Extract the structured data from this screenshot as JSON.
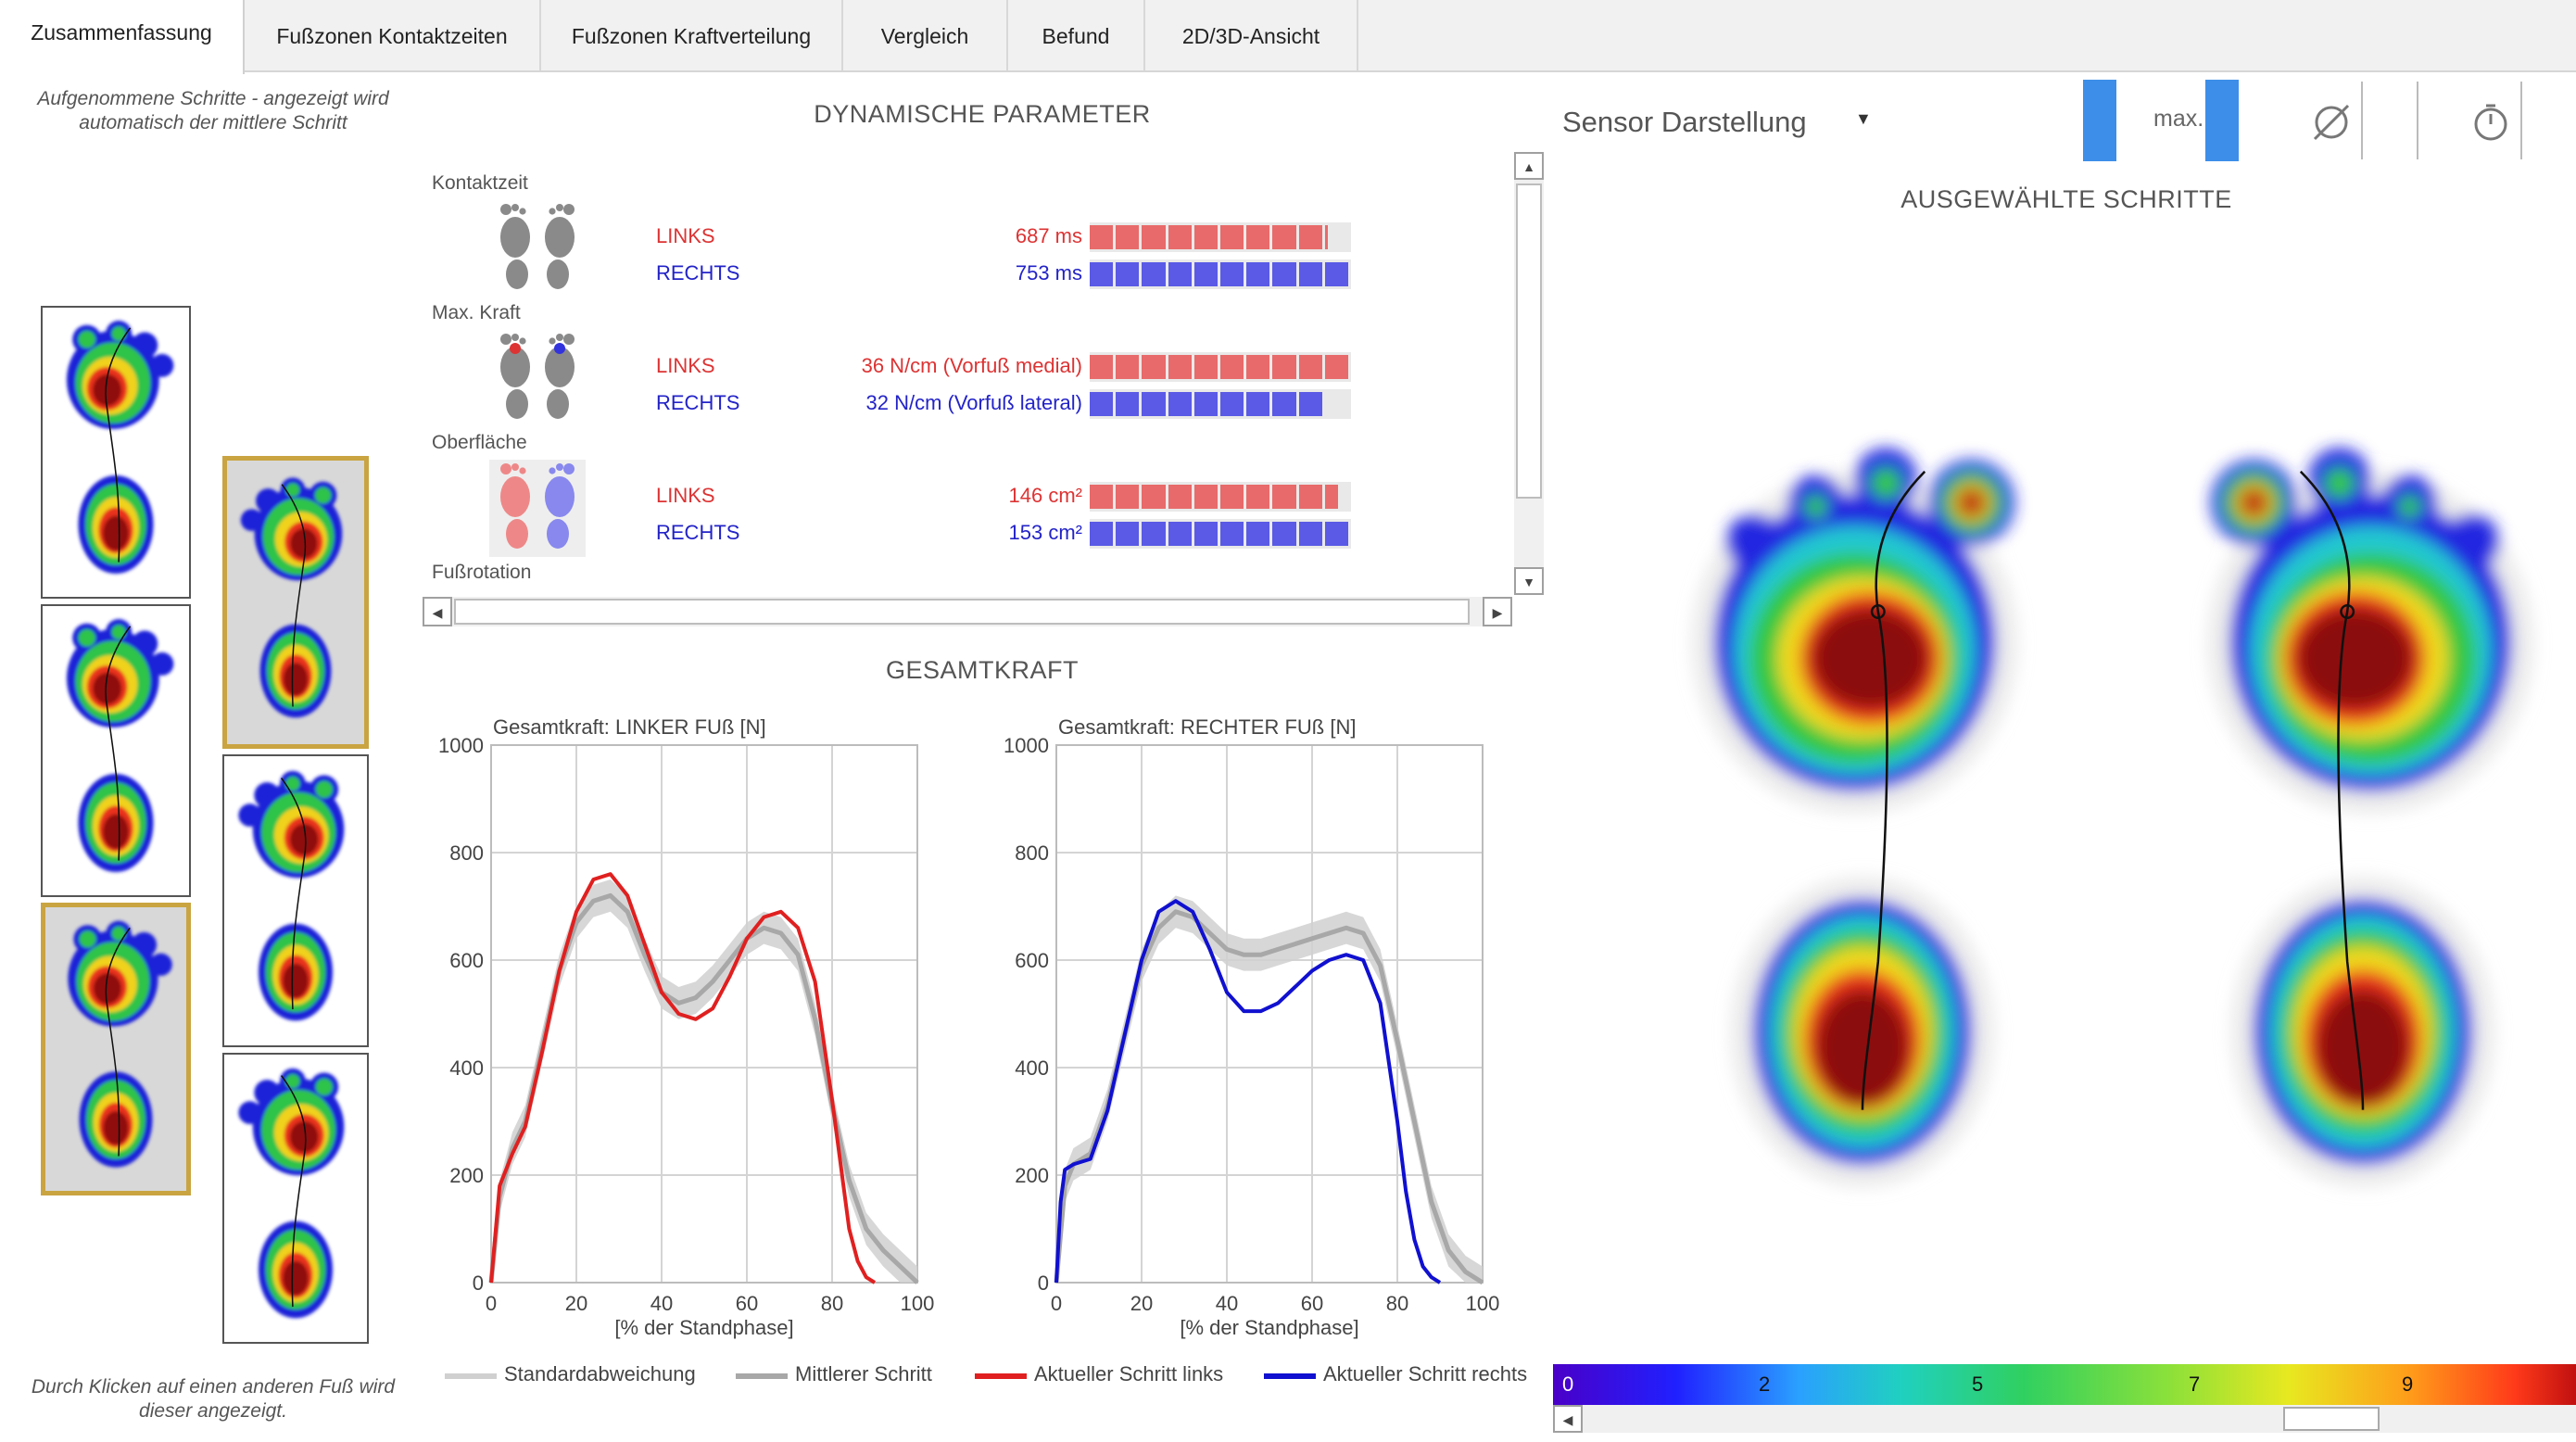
{
  "tabs": [
    {
      "label": "Zusammenfassung",
      "active": true
    },
    {
      "label": "Fußzonen Kontaktzeiten",
      "active": false
    },
    {
      "label": "Fußzonen Kraftverteilung",
      "active": false
    },
    {
      "label": "Vergleich",
      "active": false
    },
    {
      "label": "Befund",
      "active": false
    },
    {
      "label": "2D/3D-Ansicht",
      "active": false
    }
  ],
  "left_panel": {
    "top_note_line1": "Aufgenommene Schritte  - angezeigt wird",
    "top_note_line2": "automatisch der mittlere Schritt",
    "bottom_note_line1": "Durch Klicken auf einen anderen Fuß wird",
    "bottom_note_line2": "dieser angezeigt."
  },
  "dynamic": {
    "title": "DYNAMISCHE PARAMETER",
    "groups": [
      {
        "name": "Kontaktzeit",
        "left": {
          "side": "LINKS",
          "value": "687 ms",
          "fraction": 0.91
        },
        "right": {
          "side": "RECHTS",
          "value": "753 ms",
          "fraction": 1.0
        }
      },
      {
        "name": "Max. Kraft",
        "left": {
          "side": "LINKS",
          "value": "36 N/cm (Vorfuß medial)",
          "fraction": 1.0
        },
        "right": {
          "side": "RECHTS",
          "value": "32 N/cm (Vorfuß lateral)",
          "fraction": 0.89
        }
      },
      {
        "name": "Oberfläche",
        "left": {
          "side": "LINKS",
          "value": "146 cm²",
          "fraction": 0.95
        },
        "right": {
          "side": "RECHTS",
          "value": "153 cm²",
          "fraction": 1.0
        }
      }
    ],
    "next_group": "Fußrotation"
  },
  "gesamtkraft": {
    "title": "GESAMTKRAFT",
    "legend": [
      {
        "label": "Standardabweichung",
        "color": "#d0d0d0"
      },
      {
        "label": "Mittlerer Schritt",
        "color": "#a8a8a8"
      },
      {
        "label": "Aktueller Schritt links",
        "color": "#e02020"
      },
      {
        "label": "Aktueller Schritt rechts",
        "color": "#1010d0"
      }
    ]
  },
  "chart_data": [
    {
      "type": "line",
      "title": "Gesamtkraft: LINKER FUß [N]",
      "xlabel": "[% der Standphase]",
      "ylabel": "",
      "xlim": [
        0,
        100
      ],
      "ylim": [
        0,
        1000
      ],
      "xticks": [
        "0",
        "20",
        "40",
        "60",
        "80",
        "100"
      ],
      "yticks": [
        "0",
        "200",
        "400",
        "600",
        "800",
        "1000"
      ],
      "grid": true,
      "series": [
        {
          "name": "Mittlerer Schritt",
          "color": "#a8a8a8",
          "x": [
            0,
            2,
            5,
            8,
            12,
            16,
            20,
            24,
            28,
            32,
            36,
            40,
            44,
            48,
            52,
            56,
            60,
            64,
            68,
            72,
            76,
            80,
            84,
            88,
            92,
            96,
            100
          ],
          "y": [
            0,
            160,
            250,
            300,
            440,
            580,
            670,
            710,
            720,
            690,
            610,
            540,
            520,
            530,
            560,
            600,
            640,
            660,
            650,
            610,
            490,
            330,
            190,
            100,
            60,
            30,
            0
          ]
        },
        {
          "name": "Aktueller Schritt links",
          "color": "#e02020",
          "x": [
            0,
            2,
            5,
            8,
            12,
            16,
            20,
            24,
            28,
            32,
            36,
            40,
            44,
            48,
            52,
            56,
            60,
            64,
            68,
            72,
            76,
            80,
            82,
            84,
            86,
            88,
            90
          ],
          "y": [
            0,
            180,
            240,
            290,
            430,
            580,
            690,
            750,
            760,
            720,
            630,
            540,
            500,
            490,
            510,
            570,
            640,
            680,
            690,
            660,
            560,
            340,
            220,
            100,
            40,
            10,
            0
          ]
        }
      ]
    },
    {
      "type": "line",
      "title": "Gesamtkraft: RECHTER FUß [N]",
      "xlabel": "[% der Standphase]",
      "ylabel": "",
      "xlim": [
        0,
        100
      ],
      "ylim": [
        0,
        1000
      ],
      "xticks": [
        "0",
        "20",
        "40",
        "60",
        "80",
        "100"
      ],
      "yticks": [
        "0",
        "200",
        "400",
        "600",
        "800",
        "1000"
      ],
      "grid": true,
      "series": [
        {
          "name": "Mittlerer Schritt",
          "color": "#a8a8a8",
          "x": [
            0,
            2,
            4,
            8,
            12,
            16,
            20,
            24,
            28,
            32,
            36,
            40,
            44,
            48,
            52,
            56,
            60,
            64,
            68,
            72,
            76,
            80,
            84,
            88,
            92,
            96,
            100
          ],
          "y": [
            0,
            180,
            220,
            240,
            330,
            460,
            590,
            660,
            690,
            680,
            650,
            620,
            610,
            610,
            620,
            630,
            640,
            650,
            660,
            650,
            590,
            450,
            300,
            150,
            60,
            20,
            0
          ]
        },
        {
          "name": "Aktueller Schritt rechts",
          "color": "#1010d0",
          "x": [
            0,
            1,
            2,
            4,
            8,
            12,
            16,
            20,
            24,
            28,
            32,
            36,
            40,
            44,
            48,
            52,
            56,
            60,
            64,
            68,
            72,
            76,
            80,
            82,
            84,
            86,
            88,
            90
          ],
          "y": [
            0,
            150,
            210,
            220,
            230,
            320,
            460,
            600,
            690,
            710,
            690,
            620,
            540,
            505,
            505,
            520,
            550,
            580,
            600,
            610,
            600,
            520,
            300,
            170,
            80,
            30,
            10,
            0
          ]
        }
      ]
    }
  ],
  "right_panel": {
    "dropdown_label": "Sensor Darstellung",
    "max_button_label": "max.",
    "title": "AUSGEWÄHLTE SCHRITTE",
    "colorbar_ticks": [
      "0",
      "2",
      "5",
      "7",
      "9"
    ]
  }
}
